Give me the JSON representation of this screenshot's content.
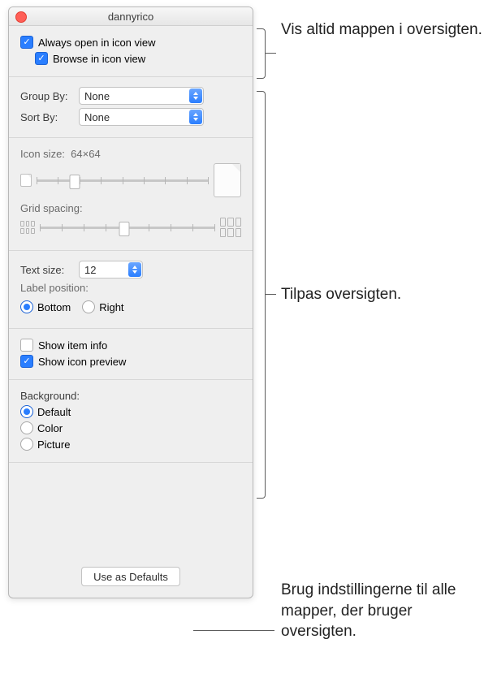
{
  "window": {
    "title": "dannyrico"
  },
  "viewOptions": {
    "alwaysOpenIconView": {
      "label": "Always open in icon view",
      "checked": true
    },
    "browseIconView": {
      "label": "Browse in icon view",
      "checked": true
    }
  },
  "group": {
    "groupByLabel": "Group By:",
    "groupByValue": "None",
    "sortByLabel": "Sort By:",
    "sortByValue": "None"
  },
  "iconSize": {
    "label": "Icon size:",
    "value": "64×64",
    "position": 22
  },
  "gridSpacing": {
    "label": "Grid spacing:",
    "position": 48
  },
  "text": {
    "sizeLabel": "Text size:",
    "sizeValue": "12",
    "labelPositionLabel": "Label position:",
    "bottom": "Bottom",
    "right": "Right",
    "selected": "bottom"
  },
  "showOptions": {
    "itemInfo": {
      "label": "Show item info",
      "checked": false
    },
    "iconPreview": {
      "label": "Show icon preview",
      "checked": true
    }
  },
  "background": {
    "label": "Background:",
    "default": "Default",
    "color": "Color",
    "picture": "Picture",
    "selected": "default"
  },
  "footer": {
    "useDefaults": "Use as Defaults"
  },
  "callouts": {
    "c1": "Vis altid mappen i oversigten.",
    "c2": "Tilpas oversigten.",
    "c3": "Brug indstillingerne til alle mapper, der bruger oversigten."
  }
}
